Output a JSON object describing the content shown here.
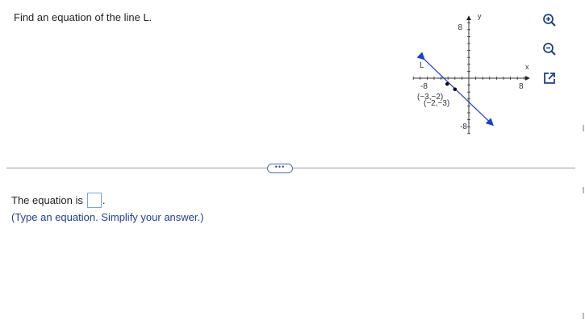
{
  "question": {
    "text": "Find an equation of the line L."
  },
  "graph": {
    "line_label": "L",
    "x_axis_label": "x",
    "y_axis_label": "y",
    "x_min_label": "-8",
    "x_max_label": "8",
    "y_max_label": "8",
    "y_min_label": "-8",
    "x_range": [
      -8,
      8
    ],
    "y_range": [
      -8,
      8
    ],
    "points": [
      {
        "label": "(−3,−2)",
        "x": -3,
        "y": -2
      },
      {
        "label": "(−2,−3)",
        "x": -2,
        "y": -3
      }
    ],
    "line_color": "#1a3fd0"
  },
  "tools": [
    {
      "name": "zoom-in-icon"
    },
    {
      "name": "zoom-out-icon"
    },
    {
      "name": "popout-icon"
    }
  ],
  "more_button": {
    "label": "•••"
  },
  "answer": {
    "prefix": "The equation is",
    "suffix": ".",
    "value": "",
    "hint": "(Type an equation. Simplify your answer.)"
  }
}
